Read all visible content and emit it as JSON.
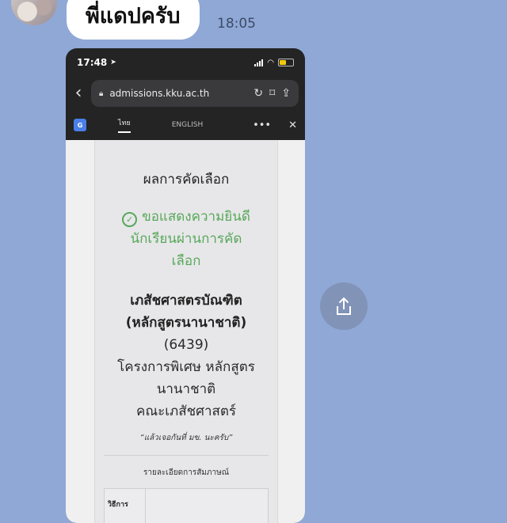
{
  "chat": {
    "message_text": "พี่แดปครับ",
    "message_time": "18:05"
  },
  "phone": {
    "status_time": "17:48",
    "url": "admissions.kku.ac.th",
    "translate_tabs": [
      "ไทย",
      "ENGLISH"
    ],
    "translate_logo": "G"
  },
  "result": {
    "title": "ผลการคัดเลือก",
    "success_lines": [
      "ขอแสดงความยินดี",
      "นักเรียนผ่านการคัด",
      "เลือก"
    ],
    "program_bold_lines": [
      "เภสัชศาสตรบัณฑิต",
      "(หลักสูตรนานาชาติ)"
    ],
    "program_lines": [
      "(6439)",
      "โครงการพิเศษ หลักสูตร",
      "นานาชาติ",
      "คณะเภสัชศาสตร์"
    ],
    "quote": "“แล้วเจอกันที่ มข. นะครับ”",
    "interview_heading": "รายละเอียดการสัมภาษณ์",
    "table_label": "วิธีการ"
  },
  "colors": {
    "background": "#8fa8d6",
    "success": "#58a85a",
    "share_button": "#8193b7"
  }
}
